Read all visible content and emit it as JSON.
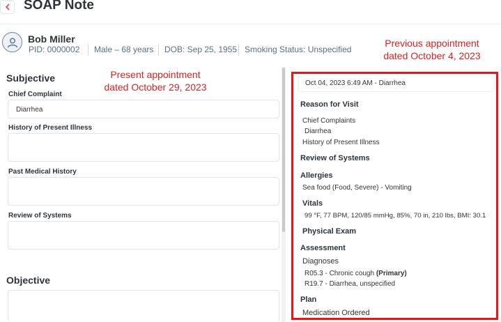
{
  "header": {
    "title": "SOAP Note",
    "back_icon": "chevron-left-icon"
  },
  "patient": {
    "name": "Bob Miller",
    "pid": "PID: 0000002",
    "sex_age": "Male – 68 years",
    "dob": "DOB: Sep 25, 1955",
    "smoking": "Smoking Status: Unspecified",
    "avatar_icon": "user-icon"
  },
  "annotations": {
    "present_line1": "Present appointment",
    "present_line2": "dated October 29, 2023",
    "previous_line1": "Previous appointment",
    "previous_line2": "dated October 4, 2023",
    "highlight_color": "#e8141c"
  },
  "form": {
    "subjective_title": "Subjective",
    "chief_complaint_label": "Chief Complaint",
    "chief_complaint_value": "Diarrhea",
    "hpi_label": "History of Present Illness",
    "pmh_label": "Past Medical History",
    "ros_label": "Review of Systems",
    "objective_title": "Objective"
  },
  "previous": {
    "selected_appointment": "Oct 04, 2023 6:49 AM - Diarrhea",
    "reason_title": "Reason for Visit",
    "chief_complaints_label": "Chief Complaints",
    "chief_complaints_value": "Diarrhea",
    "hpi_label": "History of Present Illness",
    "ros_title": "Review of Systems",
    "allergies_title": "Allergies",
    "allergy_item": "Sea food (Food, Severe) - Vomiting",
    "vitals_title": "Vitals",
    "vitals_value": "99 °F, 77 BPM, 120/85 mmHg, 85%, 70 in, 210 lbs, BMI: 30.1",
    "physical_exam_title": "Physical Exam",
    "assessment_title": "Assessment",
    "diagnoses_label": "Diagnoses",
    "diagnosis_1_text": "R05.3 - Chronic cough",
    "diagnosis_1_tag": "(Primary)",
    "diagnosis_2_text": "R19.7 - Diarrhea, unspecified",
    "plan_title": "Plan",
    "medication_label": "Medication Ordered"
  }
}
